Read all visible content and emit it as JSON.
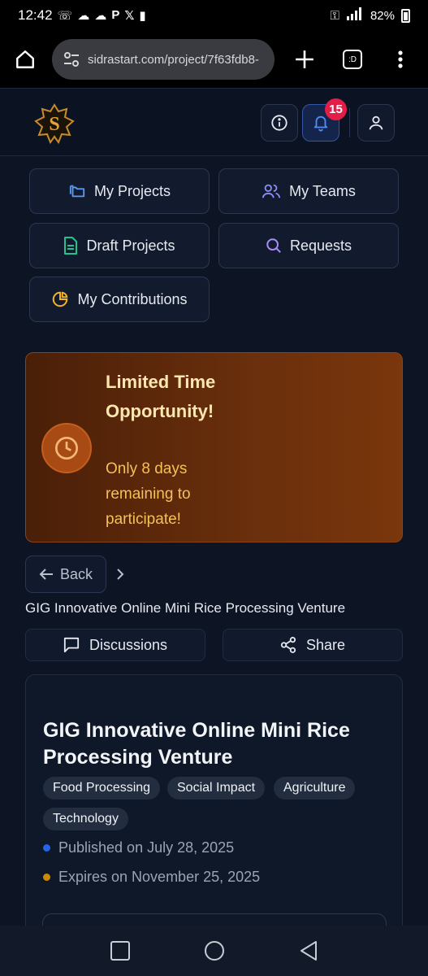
{
  "status_bar": {
    "time": "12:42",
    "notification_icons": [
      "whatsapp-icon",
      "snapchat-icon",
      "snapchat-icon",
      "paypal-icon",
      "x-icon",
      "battery-alert-icon"
    ],
    "battery": "82%"
  },
  "browser": {
    "url": "sidrastart.com/project/7f63fdb8-",
    "tab_label": ":D"
  },
  "header": {
    "notification_count": "15"
  },
  "nav": {
    "my_projects": "My Projects",
    "my_teams": "My Teams",
    "draft_projects": "Draft Projects",
    "requests": "Requests",
    "my_contributions": "My Contributions"
  },
  "promo": {
    "title": "Limited Time Opportunity!",
    "description": "Only 8 days remaining to participate!"
  },
  "breadcrumb": {
    "back": "Back",
    "current": "GIG Innovative Online Mini Rice Processing Venture"
  },
  "actions": {
    "discussions": "Discussions",
    "share": "Share"
  },
  "project": {
    "title": "GIG Innovative Online Mini Rice Processing Venture",
    "tags": [
      "Food Processing",
      "Social Impact",
      "Agriculture",
      "Technology"
    ],
    "published": "Published on July 28, 2025",
    "expires": "Expires on November 25, 2025"
  },
  "colors": {
    "accent_blue": "#3b82f6",
    "promo_orange": "#7a360c",
    "badge_red": "#e11d48",
    "published_dot": "#2563eb",
    "expires_dot": "#ca8a04"
  }
}
